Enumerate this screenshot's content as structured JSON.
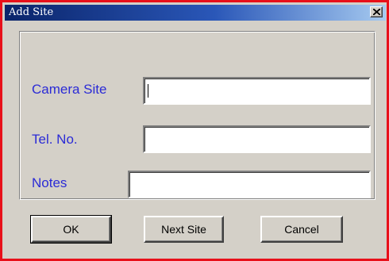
{
  "window": {
    "title": "Add Site",
    "close_icon": "close-icon"
  },
  "form": {
    "camera_site": {
      "label": "Camera Site",
      "value": ""
    },
    "tel_no": {
      "label": "Tel. No.",
      "value": ""
    },
    "notes": {
      "label": "Notes",
      "value": ""
    }
  },
  "buttons": {
    "ok": "OK",
    "next_site": "Next Site",
    "cancel": "Cancel"
  },
  "colors": {
    "window_border": "#e8101a",
    "title_bar_start": "#0a246a",
    "title_bar_end": "#a6caf0",
    "label_text": "#2b2bd6",
    "dialog_face": "#d4d0c8"
  }
}
